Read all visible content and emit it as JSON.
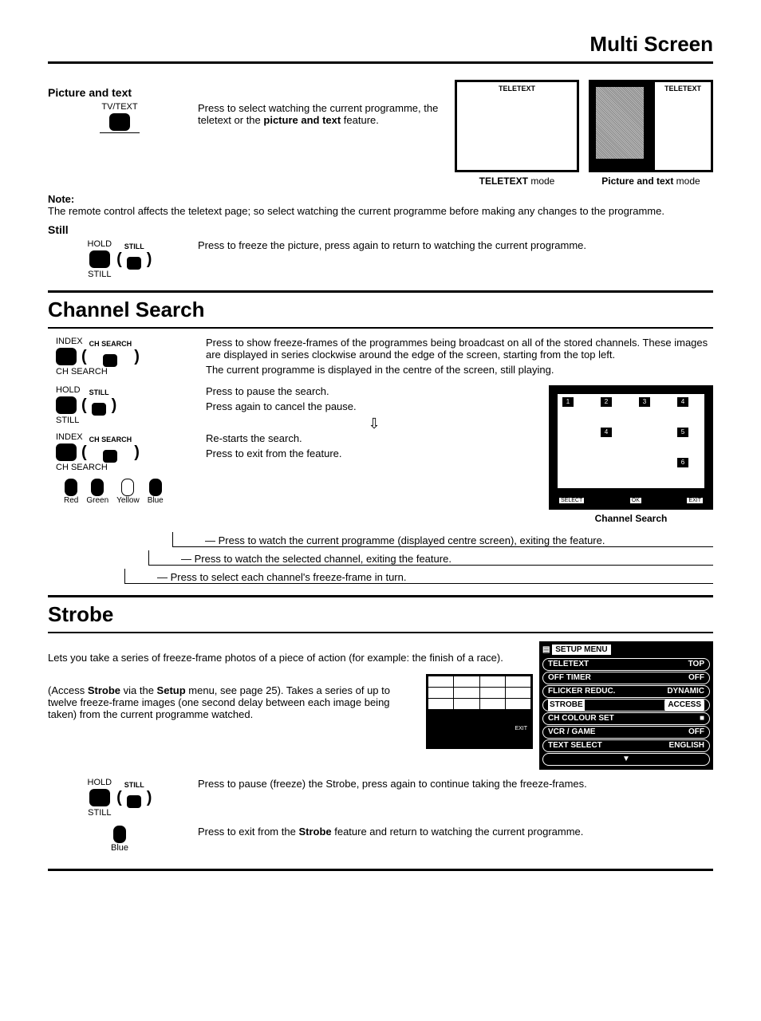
{
  "page_title": "Multi Screen",
  "picture_text": {
    "heading": "Picture and text",
    "btn_top": "TV/TEXT",
    "desc_1": "Press to select watching the current programme, the teletext or the ",
    "desc_bold": "picture and text",
    "desc_2": " feature.",
    "teletext_label": "TELETEXT",
    "caption_left_bold": "TELETEXT",
    "caption_left_rest": " mode",
    "caption_right_bold": "Picture and text",
    "caption_right_rest": " mode"
  },
  "note": {
    "label": "Note:",
    "text": "The remote control affects the teletext page; so select watching the current programme before making any changes to the programme."
  },
  "still": {
    "heading": "Still",
    "btn_top": "HOLD",
    "btn_bot": "STILL",
    "paren_label": "STILL",
    "desc": "Press to freeze the picture, press again to return to watching the current programme."
  },
  "channel_search": {
    "title": "Channel Search",
    "index_top": "INDEX",
    "index_bot": "CH SEARCH",
    "paren_label": "CH SEARCH",
    "desc1": "Press to show freeze-frames of the programmes being broadcast on all of the stored channels. These images are displayed in series clockwise around the edge of the screen, starting from the top left.",
    "desc1b": "The current programme is displayed in the centre of the screen, still playing.",
    "hold_top": "HOLD",
    "hold_bot": "STILL",
    "still_paren": "STILL",
    "desc2a": "Press to pause the search.",
    "desc2b": "Press again to cancel the pause.",
    "desc3": "Re-starts the search.",
    "desc4": "Press to exit from the feature.",
    "colors": [
      "Red",
      "Green",
      "Yellow",
      "Blue"
    ],
    "blue_line": "Press to watch the current programme (displayed centre screen), exiting the feature.",
    "green_line": "Press to watch the selected channel, exiting the feature.",
    "red_line": "Press to select each channel's freeze-frame in turn.",
    "screen_caption": "Channel Search",
    "screen_nums": [
      "1",
      "2",
      "3",
      "4",
      "4",
      "5",
      "6"
    ],
    "bar": [
      "SELECT",
      "OK",
      "EXIT"
    ]
  },
  "strobe": {
    "title": "Strobe",
    "intro": "Lets you take a series of freeze-frame photos of a piece of action (for example: the finish of a race).",
    "access_1": "(Access ",
    "access_bold": "Strobe",
    "access_2": " via the ",
    "access_bold2": "Setup",
    "access_3": " menu, see page 25). Takes a series of up to twelve freeze-frame images (one second delay between each image being taken) from the current programme watched.",
    "hold_top": "HOLD",
    "hold_bot": "STILL",
    "still_paren": "STILL",
    "pause_desc": "Press to pause (freeze) the Strobe, press again to continue taking the freeze-frames.",
    "blue_label": "Blue",
    "exit_desc_1": "Press to exit from the ",
    "exit_bold": "Strobe",
    "exit_desc_2": " feature and return to watching the current programme.",
    "grid_bar": "EXIT",
    "setup": {
      "title": "SETUP MENU",
      "rows": [
        {
          "k": "TELETEXT",
          "v": "TOP"
        },
        {
          "k": "OFF TIMER",
          "v": "OFF"
        },
        {
          "k": "FLICKER REDUC.",
          "v": "DYNAMIC"
        },
        {
          "k": "STROBE",
          "v": "ACCESS",
          "hl": true
        },
        {
          "k": "CH COLOUR SET",
          "v": "■"
        },
        {
          "k": "VCR / GAME",
          "v": "OFF"
        },
        {
          "k": "TEXT SELECT",
          "v": "ENGLISH"
        },
        {
          "k": "▼",
          "v": ""
        }
      ]
    }
  }
}
